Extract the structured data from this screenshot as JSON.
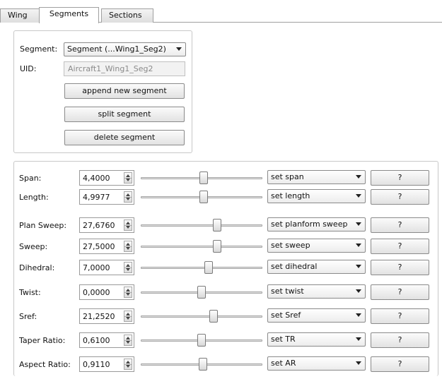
{
  "tabs": [
    {
      "label": "Wing",
      "active": false
    },
    {
      "label": "Segments",
      "active": true
    },
    {
      "label": "Sections",
      "active": false
    }
  ],
  "segment": {
    "segment_label": "Segment:",
    "segment_value": "Segment (...Wing1_Seg2)",
    "uid_label": "UID:",
    "uid_value": "Aircraft1_Wing1_Seg2",
    "append_label": "append new segment",
    "split_label": "split segment",
    "delete_label": "delete segment"
  },
  "params": [
    {
      "label": "Span:",
      "value": "4,4000",
      "slider": 0.52,
      "action": "set span",
      "help": "?"
    },
    {
      "label": "Length:",
      "value": "4,9977",
      "slider": 0.52,
      "action": "set length",
      "help": "?"
    },
    {
      "label": "Plan Sweep:",
      "value": "27,6760",
      "slider": 0.63,
      "action": "set planform sweep",
      "help": "?"
    },
    {
      "label": "Sweep:",
      "value": "27,5000",
      "slider": 0.63,
      "action": "set sweep",
      "help": "?"
    },
    {
      "label": "Dihedral:",
      "value": "7,0000",
      "slider": 0.56,
      "action": "set dihedral",
      "help": "?"
    },
    {
      "label": "Twist:",
      "value": "0,0000",
      "slider": 0.5,
      "action": "set twist",
      "help": "?"
    },
    {
      "label": "Sref:",
      "value": "21,2520",
      "slider": 0.6,
      "action": "set Sref",
      "help": "?"
    },
    {
      "label": "Taper Ratio:",
      "value": "0,6100",
      "slider": 0.5,
      "action": "set TR",
      "help": "?"
    },
    {
      "label": "Aspect Ratio:",
      "value": "0,9110",
      "slider": 0.51,
      "action": "set AR",
      "help": "?"
    }
  ]
}
